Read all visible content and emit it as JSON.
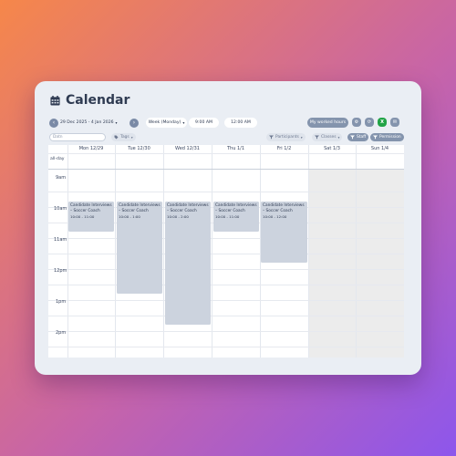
{
  "app": {
    "title": "Calendar"
  },
  "toolbar": {
    "prev": "‹",
    "next": "›",
    "date_range": "29 Dec 2025 - 4 Jan 2026",
    "date_range_caret": "▾",
    "view": "Week (Monday)",
    "view_caret": "▾",
    "start_time": "9:00 AM",
    "end_time": "12:00 AM",
    "worked_hours": "My worked hours",
    "settings_icon": "⚙",
    "refresh_icon": "⟳",
    "excel_icon": "X",
    "mail_icon": "✉"
  },
  "filters": {
    "search_placeholder": "Datn",
    "tags": "Tags",
    "tags_caret": "▾",
    "participants": "Participants",
    "participants_caret": "▾",
    "classes": "Classes",
    "classes_caret": "▾",
    "staff": "Staff",
    "permission": "Permission"
  },
  "days": [
    "Mon 12/29",
    "Tue 12/30",
    "Wed 12/31",
    "Thu 1/1",
    "Fri 1/2",
    "Sat 1/3",
    "Sun 1/4"
  ],
  "allday_label": "all-day",
  "times": [
    "9am",
    "10am",
    "11am",
    "12pm",
    "1pm",
    "2pm"
  ],
  "events": [
    {
      "title": "Candidate Interviews – Soccer Coach",
      "time": "10:00 - 11:00"
    },
    {
      "title": "Candidate Interviews – Soccer Coach",
      "time": "10:00 - 1:00"
    },
    {
      "title": "Candidate Interviews – Soccer Coach",
      "time": "10:00 - 2:00"
    },
    {
      "title": "Candidate Interviews – Soccer Coach",
      "time": "10:00 - 11:00"
    },
    {
      "title": "Candidate Interviews – Soccer Coach",
      "time": "10:00 - 12:00"
    }
  ],
  "colors": {
    "weekend": "#ececec",
    "event": "#ccd3de",
    "accent": "#8494ad",
    "excel": "#22a447"
  }
}
